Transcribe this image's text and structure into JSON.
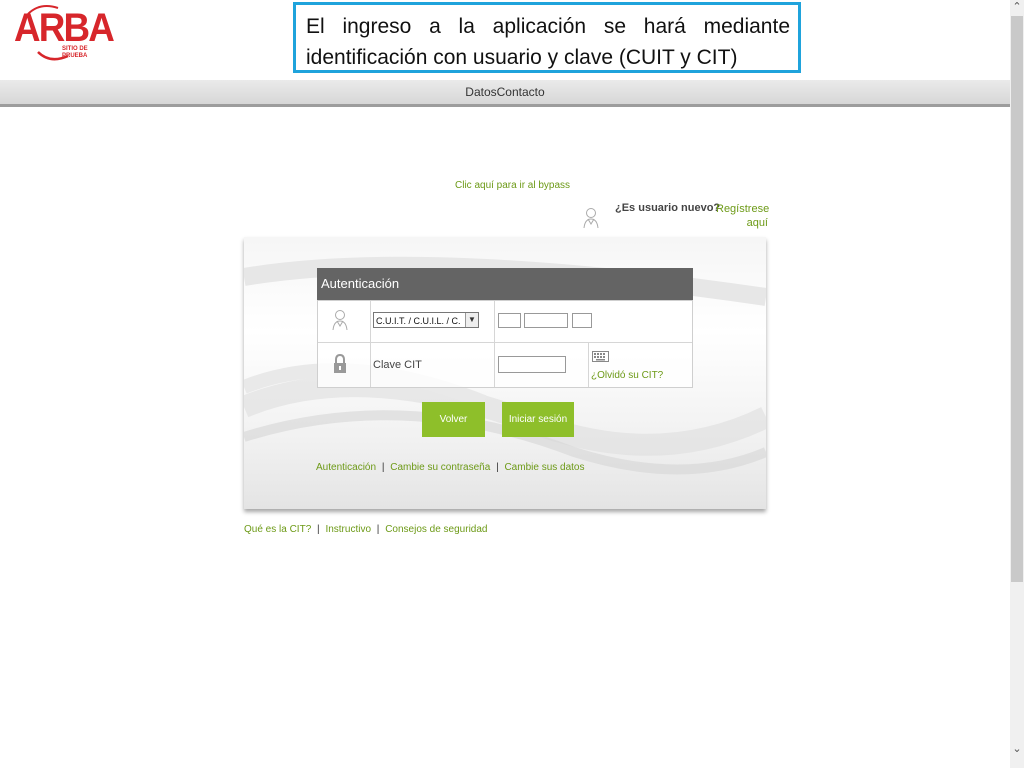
{
  "logo": {
    "text": "ARBA",
    "subtext": "SITIO DE PRUEBA"
  },
  "callout": {
    "text": "El ingreso a la aplicación se hará mediante identificación con usuario y clave (CUIT y CIT)"
  },
  "topbar": {
    "title": "DatosContacto"
  },
  "links": {
    "bypass": "Clic aquí para ir al bypass",
    "new_user_question": "¿Es usuario nuevo?",
    "register": "Regístrese aquí"
  },
  "auth": {
    "title": "Autenticación",
    "id_type_selected": "C.U.I.T. / C.U.I.L. / C.",
    "password_label": "Clave CIT",
    "forgot": "¿Olvidó su CIT?",
    "btn_back": "Volver",
    "btn_login": "Iniciar sesión"
  },
  "panel_links": [
    "Autenticación",
    "Cambie su contraseña",
    "Cambie sus datos"
  ],
  "footer_links": [
    "Qué es la CIT?",
    "Instructivo",
    "Consejos de seguridad"
  ],
  "colors": {
    "accent_green": "#8ebf2a",
    "link_green": "#6d9a17",
    "brand_red": "#d7262b",
    "callout_border": "#1fa3dc"
  },
  "icons": [
    "user-icon",
    "lock-icon",
    "keyboard-icon",
    "chevron-down-icon"
  ]
}
